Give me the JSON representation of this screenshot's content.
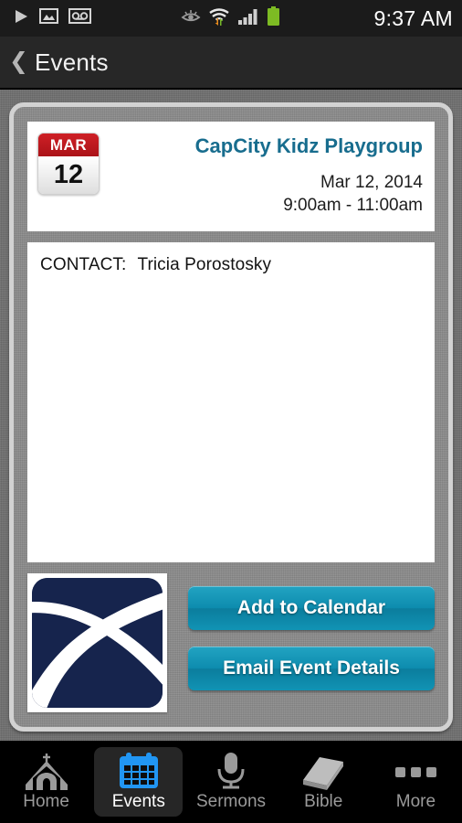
{
  "status_bar": {
    "time": "9:37 AM",
    "left_icons": [
      "play-icon",
      "photo-icon",
      "voicemail-icon"
    ],
    "right_icons": [
      "eye-icon",
      "wifi-transfer-icon",
      "signal-bars-icon",
      "battery-icon"
    ]
  },
  "title_bar": {
    "back_chevron": "❮",
    "title": "Events"
  },
  "event": {
    "calendar_icon": {
      "month": "MAR",
      "day": "12"
    },
    "title": "CapCity Kidz Playgroup",
    "date": "Mar 12, 2014",
    "time": "9:00am - 11:00am",
    "contact_label": "CONTACT:",
    "contact_name": "Tricia Porostosky",
    "description": ""
  },
  "actions": {
    "add_to_calendar": "Add to Calendar",
    "email_event_details": "Email Event Details"
  },
  "logo": {
    "name": "church-logo",
    "background_color": "#16244d",
    "mark_color": "#ffffff"
  },
  "tab_bar": {
    "active": "Events",
    "items": [
      {
        "label": "Home",
        "icon": "church-icon",
        "active": false
      },
      {
        "label": "Events",
        "icon": "calendar-icon",
        "active": true
      },
      {
        "label": "Sermons",
        "icon": "microphone-icon",
        "active": false
      },
      {
        "label": "Bible",
        "icon": "book-icon",
        "active": false
      },
      {
        "label": "More",
        "icon": "ellipsis-icon",
        "active": false
      }
    ]
  },
  "colors": {
    "accent_teal": "#0d8cae",
    "title_blue": "#186d8e",
    "calendar_red": "#c41b21",
    "active_tab_blue": "#2196f3",
    "navy": "#16244d"
  }
}
